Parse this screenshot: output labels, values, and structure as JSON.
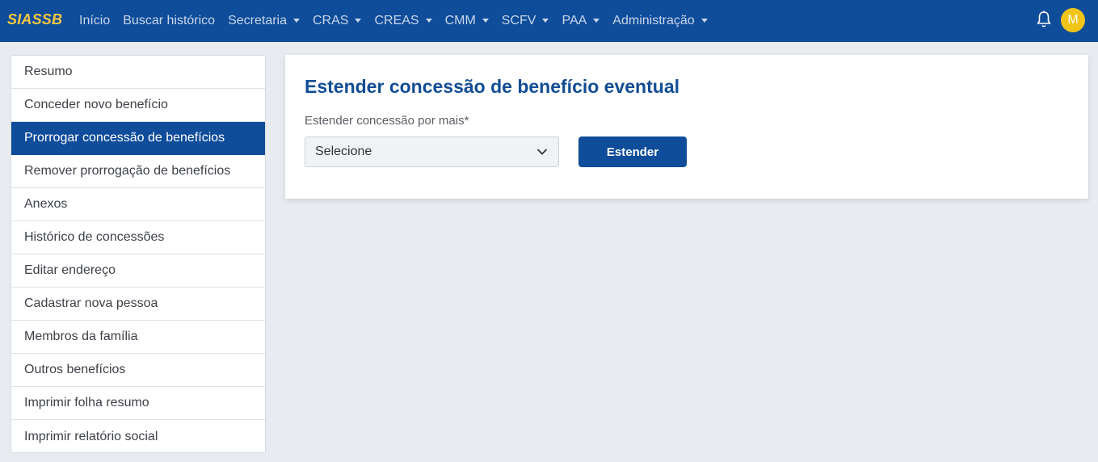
{
  "navbar": {
    "brand": "SIASSB",
    "items": [
      {
        "label": "Início",
        "dropdown": false
      },
      {
        "label": "Buscar histórico",
        "dropdown": false
      },
      {
        "label": "Secretaria",
        "dropdown": true
      },
      {
        "label": "CRAS",
        "dropdown": true
      },
      {
        "label": "CREAS",
        "dropdown": true
      },
      {
        "label": "CMM",
        "dropdown": true
      },
      {
        "label": "SCFV",
        "dropdown": true
      },
      {
        "label": "PAA",
        "dropdown": true
      },
      {
        "label": "Administração",
        "dropdown": true
      }
    ],
    "avatar_initial": "M",
    "icons": {
      "notifications": "bell-icon"
    }
  },
  "sidebar": {
    "items": [
      {
        "label": "Resumo",
        "active": false
      },
      {
        "label": "Conceder novo benefício",
        "active": false
      },
      {
        "label": "Prorrogar concessão de benefícios",
        "active": true
      },
      {
        "label": "Remover prorrogação de benefícios",
        "active": false
      },
      {
        "label": "Anexos",
        "active": false
      },
      {
        "label": "Histórico de concessões",
        "active": false
      },
      {
        "label": "Editar endereço",
        "active": false
      },
      {
        "label": "Cadastrar nova pessoa",
        "active": false
      },
      {
        "label": "Membros da família",
        "active": false
      },
      {
        "label": "Outros benefícios",
        "active": false
      },
      {
        "label": "Imprimir folha resumo",
        "active": false
      },
      {
        "label": "Imprimir relatório social",
        "active": false
      }
    ]
  },
  "main": {
    "title": "Estender concessão de benefício eventual",
    "field_label": "Estender concessão por mais*",
    "select_value": "Selecione",
    "button_label": "Estender"
  },
  "colors": {
    "primary": "#0f4c9a",
    "brand": "#f5c842",
    "avatar": "#f0c419",
    "background": "#e8ebef"
  }
}
